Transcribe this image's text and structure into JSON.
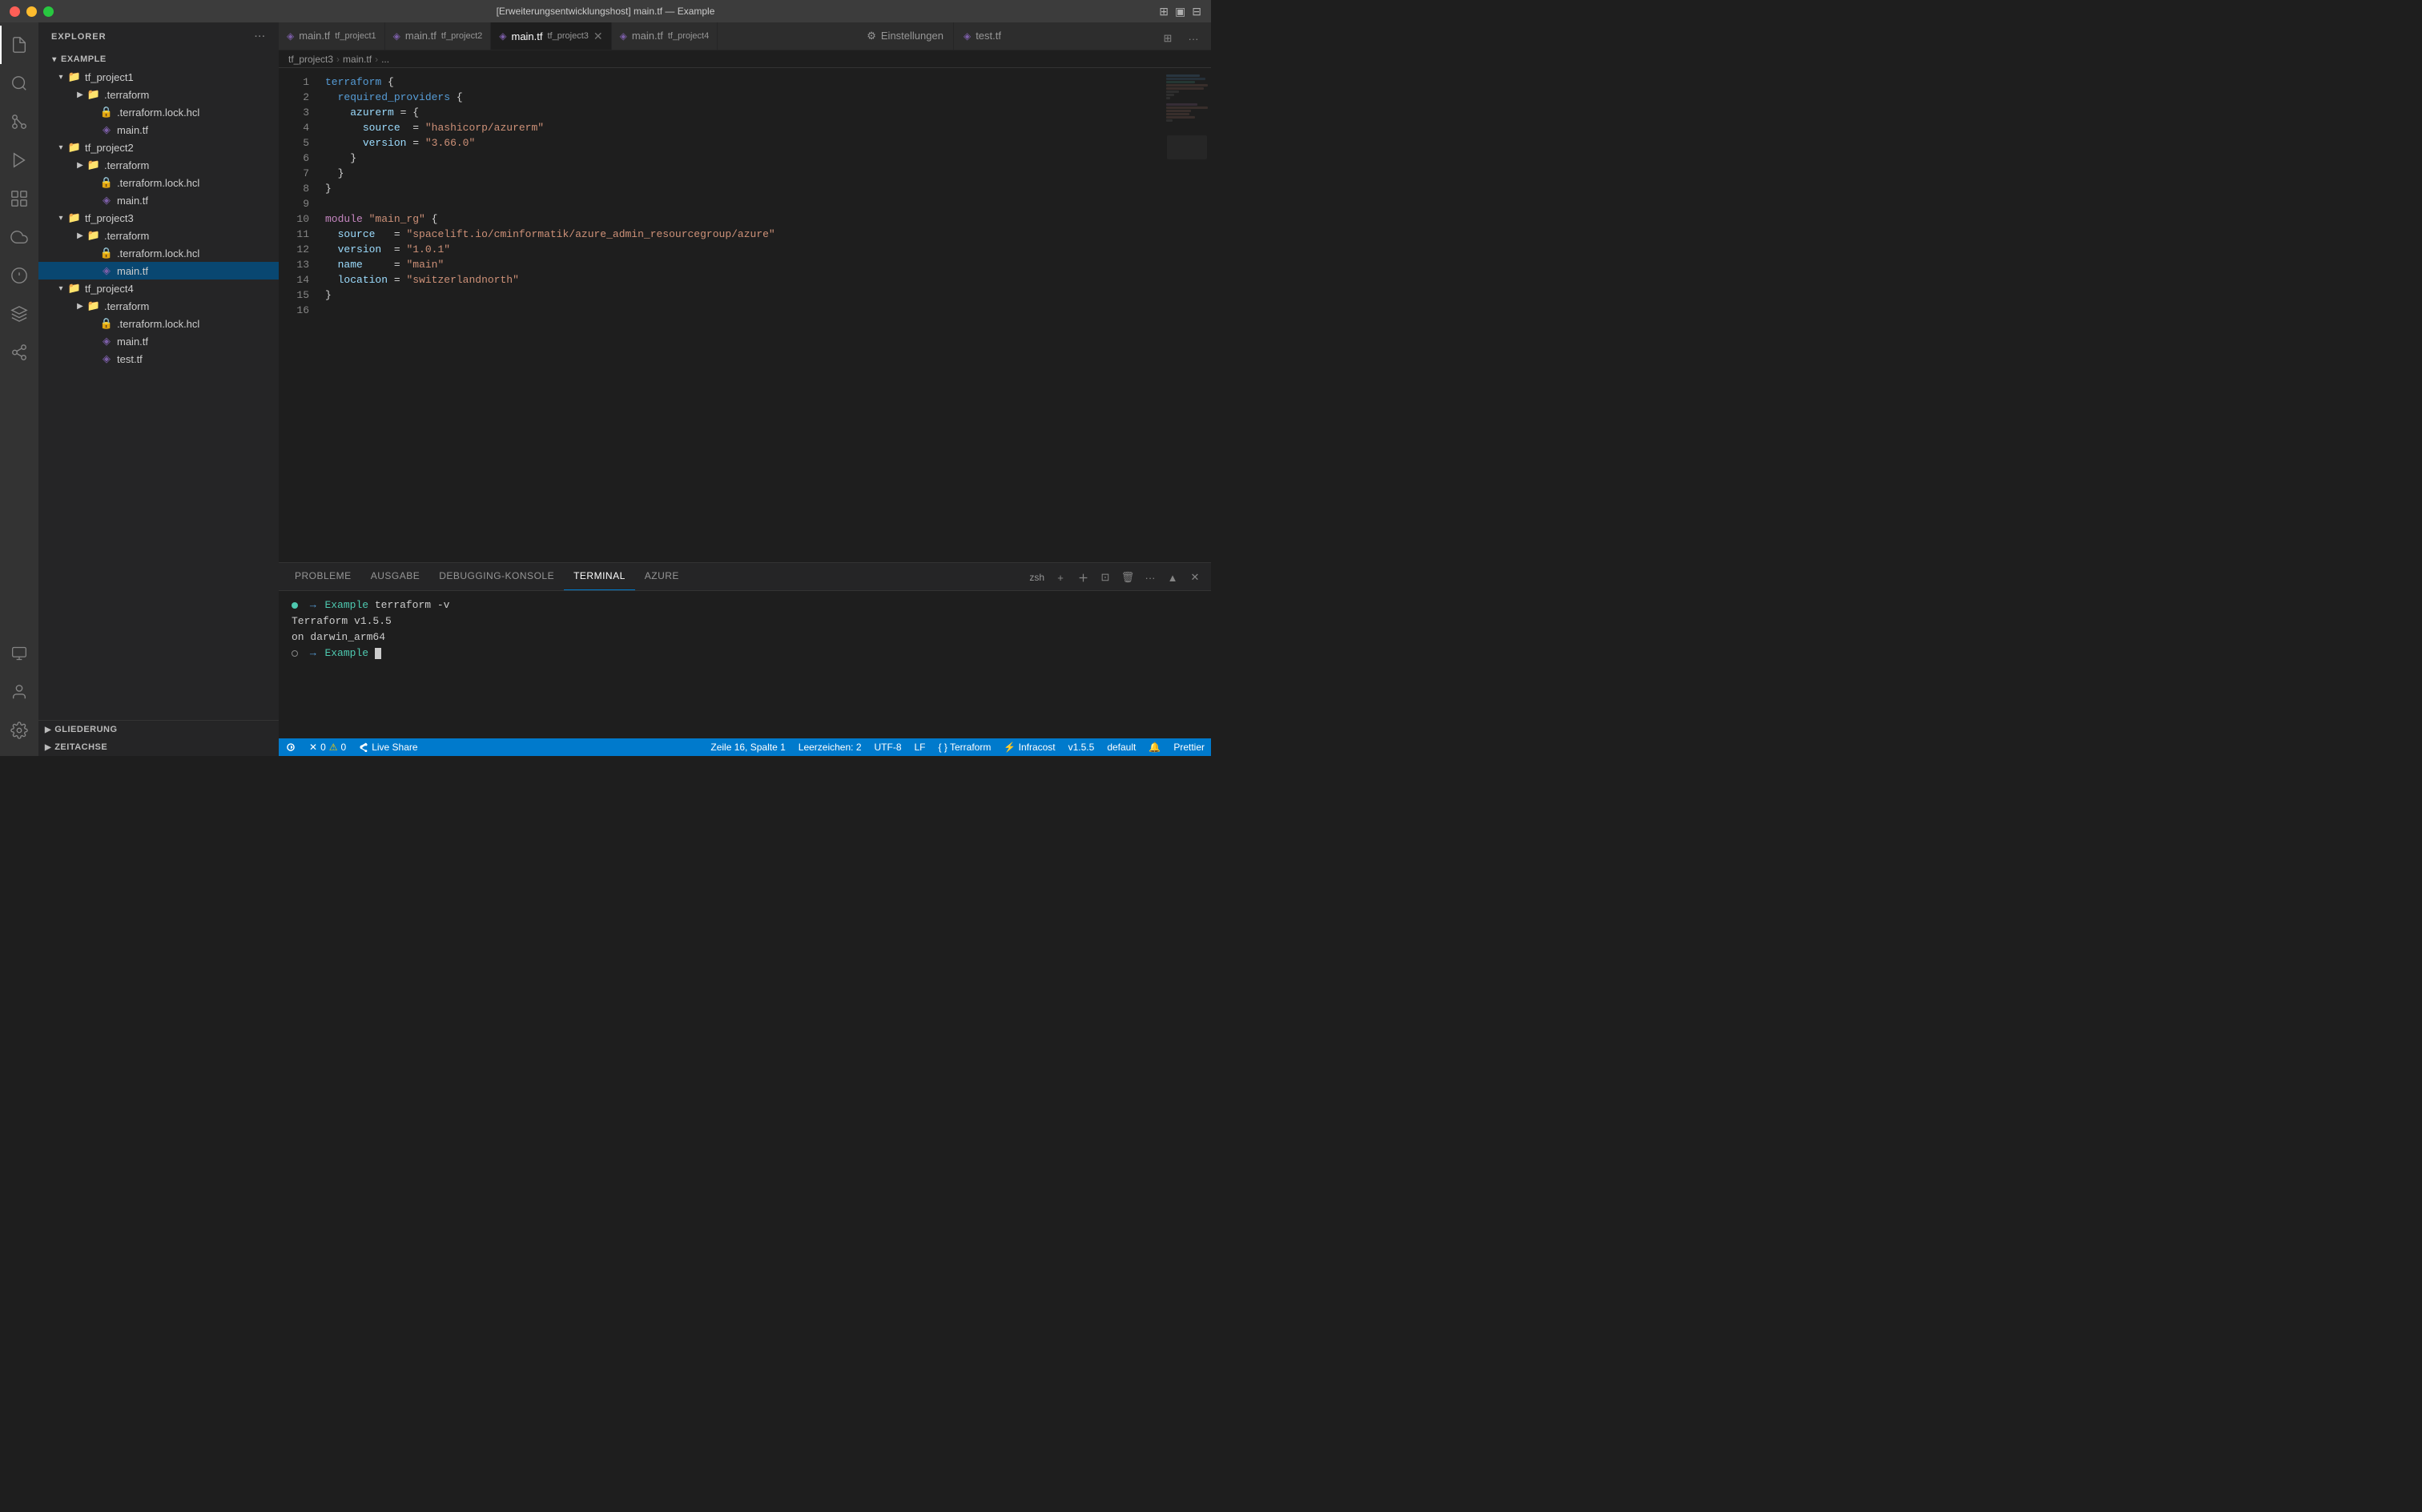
{
  "titlebar": {
    "title": "[Erweiterungsentwicklungshost] main.tf — Example",
    "buttons": {
      "close": "close",
      "minimize": "minimize",
      "maximize": "maximize"
    }
  },
  "tabs": [
    {
      "icon": "tf",
      "name": "main.tf",
      "project": "tf_project1",
      "active": false,
      "closable": false
    },
    {
      "icon": "tf",
      "name": "main.tf",
      "project": "tf_project2",
      "active": false,
      "closable": false
    },
    {
      "icon": "tf",
      "name": "main.tf",
      "project": "tf_project3",
      "active": true,
      "closable": true
    },
    {
      "icon": "tf",
      "name": "main.tf",
      "project": "tf_project4",
      "active": false,
      "closable": false
    }
  ],
  "settings_tab": {
    "icon": "⚙",
    "name": "Einstellungen"
  },
  "test_tab": {
    "icon": "tf",
    "name": "test.tf"
  },
  "breadcrumb": {
    "parts": [
      "tf_project3",
      "main.tf",
      "..."
    ]
  },
  "editor": {
    "language": "terraform",
    "lines": [
      {
        "num": 1,
        "content": "terraform {"
      },
      {
        "num": 2,
        "content": "  required_providers {"
      },
      {
        "num": 3,
        "content": "    azurerm = {"
      },
      {
        "num": 4,
        "content": "      source  = \"hashicorp/azurerm\""
      },
      {
        "num": 5,
        "content": "      version = \"3.66.0\""
      },
      {
        "num": 6,
        "content": "    }"
      },
      {
        "num": 7,
        "content": "  }"
      },
      {
        "num": 8,
        "content": "}"
      },
      {
        "num": 9,
        "content": ""
      },
      {
        "num": 10,
        "content": "module \"main_rg\" {"
      },
      {
        "num": 11,
        "content": "  source   = \"spacelift.io/cminformatik/azure_admin_resourcegroup/azure\""
      },
      {
        "num": 12,
        "content": "  version  = \"1.0.1\""
      },
      {
        "num": 13,
        "content": "  name     = \"main\""
      },
      {
        "num": 14,
        "content": "  location = \"switzerlandnorth\""
      },
      {
        "num": 15,
        "content": "}"
      },
      {
        "num": 16,
        "content": ""
      }
    ]
  },
  "panel": {
    "tabs": [
      {
        "name": "PROBLEME",
        "active": false
      },
      {
        "name": "AUSGABE",
        "active": false
      },
      {
        "name": "DEBUGGING-KONSOLE",
        "active": false
      },
      {
        "name": "TERMINAL",
        "active": true
      },
      {
        "name": "AZURE",
        "active": false
      }
    ],
    "terminal": {
      "shell": "zsh",
      "lines": [
        {
          "type": "command",
          "dir": "Example",
          "cmd": "terraform -v"
        },
        {
          "type": "output",
          "text": "Terraform v1.5.5"
        },
        {
          "type": "output",
          "text": "on darwin_arm64"
        },
        {
          "type": "prompt",
          "dir": "Example",
          "cursor": true
        }
      ]
    }
  },
  "sidebar": {
    "title": "EXPLORER",
    "workspace": "EXAMPLE",
    "tree": {
      "projects": [
        {
          "name": "tf_project1",
          "expanded": true,
          "children": [
            {
              "name": ".terraform",
              "type": "folder",
              "expanded": false
            },
            {
              "name": ".terraform.lock.hcl",
              "type": "hcl"
            },
            {
              "name": "main.tf",
              "type": "tf"
            }
          ]
        },
        {
          "name": "tf_project2",
          "expanded": true,
          "children": [
            {
              "name": ".terraform",
              "type": "folder",
              "expanded": false
            },
            {
              "name": ".terraform.lock.hcl",
              "type": "hcl"
            },
            {
              "name": "main.tf",
              "type": "tf"
            }
          ]
        },
        {
          "name": "tf_project3",
          "expanded": true,
          "active": true,
          "children": [
            {
              "name": ".terraform",
              "type": "folder",
              "expanded": false
            },
            {
              "name": ".terraform.lock.hcl",
              "type": "hcl"
            },
            {
              "name": "main.tf",
              "type": "tf",
              "active": true
            }
          ]
        },
        {
          "name": "tf_project4",
          "expanded": true,
          "children": [
            {
              "name": ".terraform",
              "type": "folder",
              "expanded": false
            },
            {
              "name": ".terraform.lock.hcl",
              "type": "hcl"
            },
            {
              "name": "main.tf",
              "type": "tf"
            },
            {
              "name": "test.tf",
              "type": "tf"
            }
          ]
        }
      ]
    },
    "sections": [
      {
        "name": "GLIEDERUNG",
        "expanded": false
      },
      {
        "name": "ZEITACHSE",
        "expanded": false
      }
    ]
  },
  "statusbar": {
    "left": [
      {
        "icon": "remote",
        "text": "",
        "type": "remote-icon"
      },
      {
        "icon": "⚠",
        "count": "0",
        "type": "warning"
      },
      {
        "icon": "✗",
        "count": "0",
        "type": "error"
      }
    ],
    "live_share": "Live Share",
    "right": [
      {
        "text": "Zeile 16, Spalte 1"
      },
      {
        "text": "Leerzeichen: 2"
      },
      {
        "text": "UTF-8"
      },
      {
        "text": "LF"
      },
      {
        "text": "{ } Terraform"
      },
      {
        "text": "⚡ Infracost"
      },
      {
        "text": "v1.5.5"
      },
      {
        "text": "default"
      },
      {
        "icon": "🔔",
        "type": "bell"
      },
      {
        "text": "Prettier"
      }
    ]
  },
  "activity_bar": {
    "top": [
      {
        "name": "explorer",
        "icon": "files",
        "active": true
      },
      {
        "name": "search",
        "icon": "search"
      },
      {
        "name": "source-control",
        "icon": "git"
      },
      {
        "name": "run-debug",
        "icon": "debug"
      },
      {
        "name": "extensions",
        "icon": "extensions"
      }
    ],
    "bottom": [
      {
        "name": "remote-explorer",
        "icon": "remote"
      },
      {
        "name": "accounts",
        "icon": "person"
      },
      {
        "name": "settings",
        "icon": "gear"
      }
    ]
  }
}
